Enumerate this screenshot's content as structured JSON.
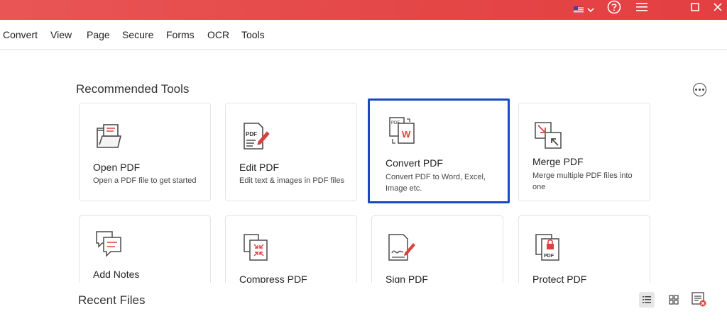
{
  "titlebar": {
    "icons": [
      "us-flag-icon",
      "chevron-down-icon",
      "help-icon",
      "hamburger-menu-icon",
      "maximize-icon",
      "close-icon"
    ]
  },
  "menu": {
    "items": [
      "Convert",
      "View",
      "Page",
      "Secure",
      "Forms",
      "OCR",
      "Tools"
    ]
  },
  "recommended": {
    "title": "Recommended Tools",
    "more_icon": "ellipsis-circle-icon",
    "tools": [
      {
        "title": "Open PDF",
        "desc": "Open a PDF file to get started",
        "icon": "open-folder-icon"
      },
      {
        "title": "Edit PDF",
        "desc": "Edit text & images in PDF files",
        "icon": "edit-pdf-icon"
      },
      {
        "title": "Convert PDF",
        "desc": "Convert PDF to Word, Excel, Image etc.",
        "icon": "convert-pdf-icon",
        "selected": true
      },
      {
        "title": "Merge PDF",
        "desc": "Merge multiple PDF files into one",
        "icon": "merge-icon"
      },
      {
        "title": "Add Notes",
        "desc": "",
        "icon": "notes-icon"
      },
      {
        "title": "Compress PDF",
        "desc": "",
        "icon": "compress-icon"
      },
      {
        "title": "Sign PDF",
        "desc": "",
        "icon": "signature-icon"
      },
      {
        "title": "Protect PDF",
        "desc": "",
        "icon": "lock-pdf-icon"
      }
    ]
  },
  "recent": {
    "title": "Recent Files",
    "view_icons": [
      "list-view-icon",
      "grid-view-icon",
      "clear-list-icon"
    ]
  },
  "colors": {
    "titlebar": "#e44646",
    "accent_red": "#d9433f",
    "selected_border": "#1849c5"
  }
}
